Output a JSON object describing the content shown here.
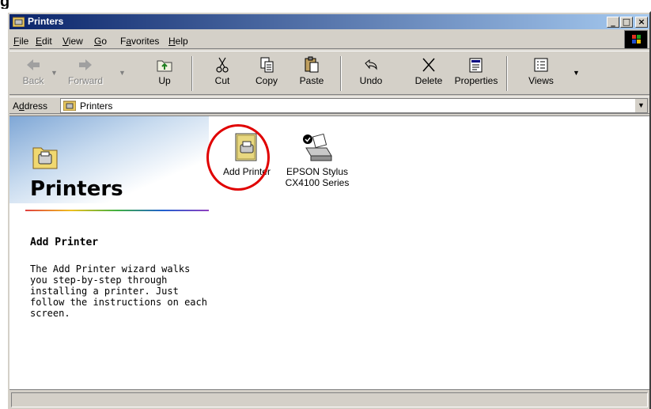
{
  "window": {
    "title": "Printers",
    "controls": {
      "minimize": "_",
      "maximize": "□",
      "close": "×"
    }
  },
  "menu": [
    {
      "label": "File",
      "ul": "F",
      "rest": "ile"
    },
    {
      "label": "Edit",
      "ul": "E",
      "rest": "dit"
    },
    {
      "label": "View",
      "ul": "V",
      "rest": "iew"
    },
    {
      "label": "Go",
      "ul": "G",
      "rest": "o"
    },
    {
      "label": "Favorites",
      "pre": "F",
      "ul": "a",
      "rest": "vorites"
    },
    {
      "label": "Help",
      "ul": "H",
      "rest": "elp"
    }
  ],
  "toolbar": {
    "back": "Back",
    "forward": "Forward",
    "up": "Up",
    "cut": "Cut",
    "copy": "Copy",
    "paste": "Paste",
    "undo": "Undo",
    "delete": "Delete",
    "properties": "Properties",
    "views": "Views"
  },
  "address": {
    "label_pre": "A",
    "label_ul": "d",
    "label_rest": "dress",
    "value": "Printers"
  },
  "left_pane": {
    "title": "Printers",
    "heading": "Add Printer",
    "description": "The Add Printer wizard walks you step-by-step through installing a printer. Just follow the instructions on each screen."
  },
  "items": [
    {
      "label": "Add Printer"
    },
    {
      "label_line1": "EPSON Stylus",
      "label_line2": "CX4100 Series"
    }
  ],
  "colors": {
    "title_gradient_start": "#0a246a",
    "title_gradient_end": "#a6caf0",
    "highlight_circle": "#e00000",
    "face": "#d4d0c8"
  },
  "icons": [
    "back-arrow-icon",
    "forward-arrow-icon",
    "up-folder-icon",
    "scissors-icon",
    "copy-icon",
    "paste-icon",
    "undo-icon",
    "delete-x-icon",
    "properties-icon",
    "views-icon",
    "printer-folder-icon",
    "add-printer-icon",
    "printer-icon"
  ]
}
